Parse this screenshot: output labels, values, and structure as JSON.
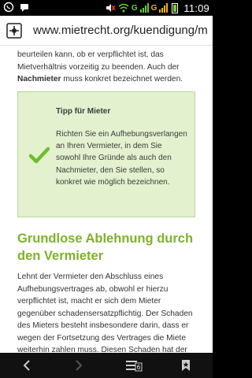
{
  "status_bar": {
    "network_1": "G",
    "network_2": "G",
    "time": "11:09",
    "icons": [
      "whatsapp-icon",
      "chat-icon",
      "mute-icon",
      "wifi-icon",
      "signal-icon",
      "battery-icon"
    ]
  },
  "url_bar": {
    "url": "www.mietrecht.org/kuendigung/m",
    "site_icon": "site-favicon-icon"
  },
  "content": {
    "intro_line1": "beurteilen kann, ob er verpflichtet ist, das",
    "intro_line2": "Mietverhältnis vorzeitig zu beenden. Auch der",
    "intro_bold": "Nachmieter",
    "intro_line3_rest": " muss konkret bezeichnet werden.",
    "tip_title": "Tipp für Mieter",
    "tip_text": "Richten Sie ein Aufhebungsverlangen an Ihren Vermieter, in dem Sie sowohl Ihre Gründe als auch den Nachmieter, den Sie stellen, so konkret wie möglich bezeichnen.",
    "section_heading": "Grundlose Ablehnung durch den Vermieter",
    "body_paragraph": "Lehnt der Vermieter den Abschluss eines Aufhebungsvertrages ab, obwohl er hierzu verpflichtet ist, macht er sich dem Mieter gegenüber schadensersatzpflichtig. Der Schaden des Mieters besteht insbesondere darin, dass er wegen der Fortsetzung des Vertrages die Miete weiterhin zahlen muss. Diesen Schaden hat der Vermieter dem Mieter zu ersetzen, wenn er"
  },
  "nav_bar": {
    "tab_count": "6",
    "buttons": [
      "back-icon",
      "forward-icon",
      "tabs-icon",
      "bookmark-icon"
    ]
  },
  "colors": {
    "accent_green": "#7cb328",
    "tip_background": "#e3f1cf",
    "tip_border": "#b8d89a",
    "check_green": "#6fbe2c"
  }
}
